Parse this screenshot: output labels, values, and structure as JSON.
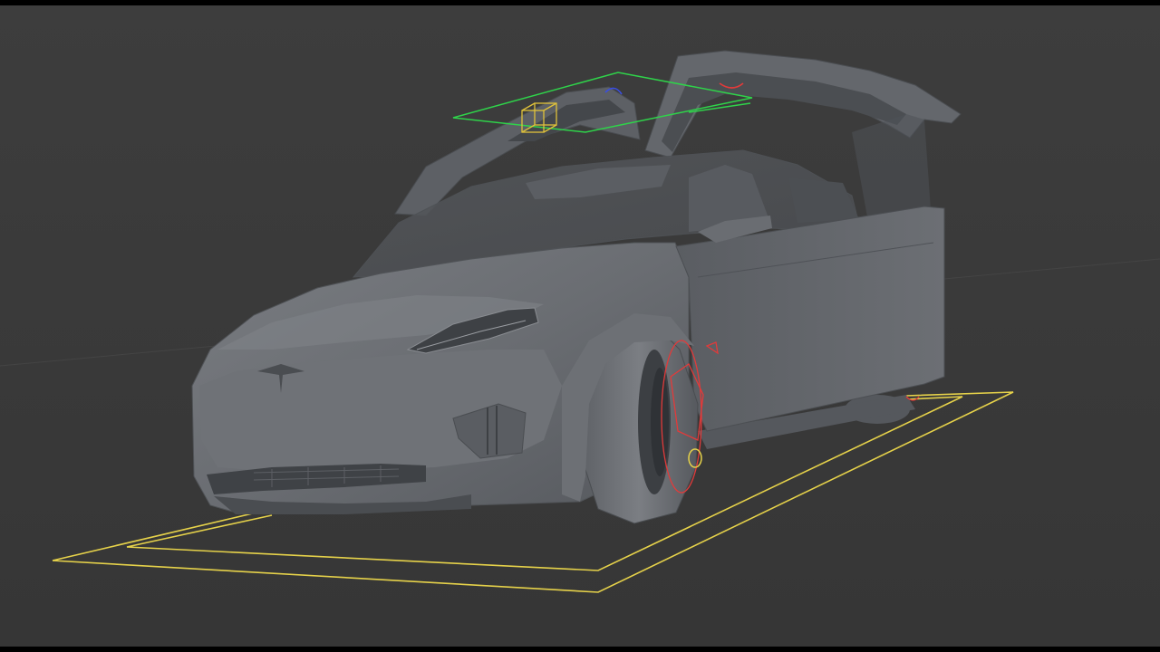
{
  "viewport": {
    "background_color": "#3b3b3b",
    "letterbox_color": "#000000",
    "object": "car-model",
    "rig_colors": {
      "floor_controls": "#e6d24a",
      "door_controls": "#2fd34a",
      "wheel_controls": "#e23a3a",
      "pivot_control": "#e0c23a",
      "rotation_control": "#3a4ee0"
    },
    "body_color": "#66696e"
  }
}
